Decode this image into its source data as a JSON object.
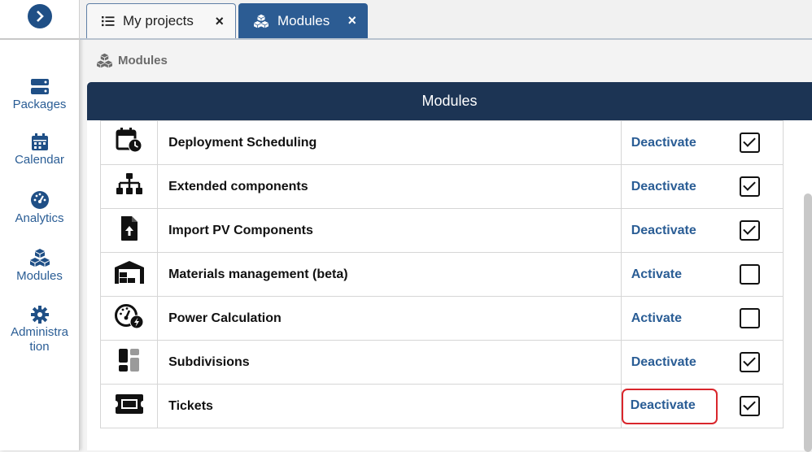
{
  "sidebar": {
    "toggle_icon": "chevron-right-icon",
    "items": [
      {
        "label": "Packages",
        "icon": "server-icon"
      },
      {
        "label": "Calendar",
        "icon": "calendar-icon"
      },
      {
        "label": "Analytics",
        "icon": "gauge-icon"
      },
      {
        "label": "Modules",
        "icon": "cubes-icon"
      },
      {
        "label": "Administra tion",
        "icon": "gear-icon"
      }
    ]
  },
  "tabs": [
    {
      "label": "My projects",
      "icon": "list-icon",
      "close": "×"
    },
    {
      "label": "Modules",
      "icon": "cubes-icon",
      "close": "×"
    }
  ],
  "breadcrumb": {
    "label": "Modules",
    "icon": "cubes-icon"
  },
  "panel": {
    "title": "Modules"
  },
  "modules": [
    {
      "name": "Deployment Scheduling",
      "action": "Deactivate",
      "active": true,
      "icon": "calendar-clock-icon"
    },
    {
      "name": "Extended components",
      "action": "Deactivate",
      "active": true,
      "icon": "sitemap-icon"
    },
    {
      "name": "Import PV Components",
      "action": "Deactivate",
      "active": true,
      "icon": "file-upload-icon"
    },
    {
      "name": "Materials management (beta)",
      "action": "Activate",
      "active": false,
      "icon": "warehouse-icon"
    },
    {
      "name": "Power Calculation",
      "action": "Activate",
      "active": false,
      "icon": "power-gauge-icon"
    },
    {
      "name": "Subdivisions",
      "action": "Deactivate",
      "active": true,
      "icon": "subdivision-icon"
    },
    {
      "name": "Tickets",
      "action": "Deactivate",
      "active": true,
      "icon": "ticket-icon"
    }
  ],
  "colors": {
    "accent": "#2c5c93",
    "header": "#1c3454",
    "link": "#2a5d95",
    "highlight": "#d9262c"
  }
}
